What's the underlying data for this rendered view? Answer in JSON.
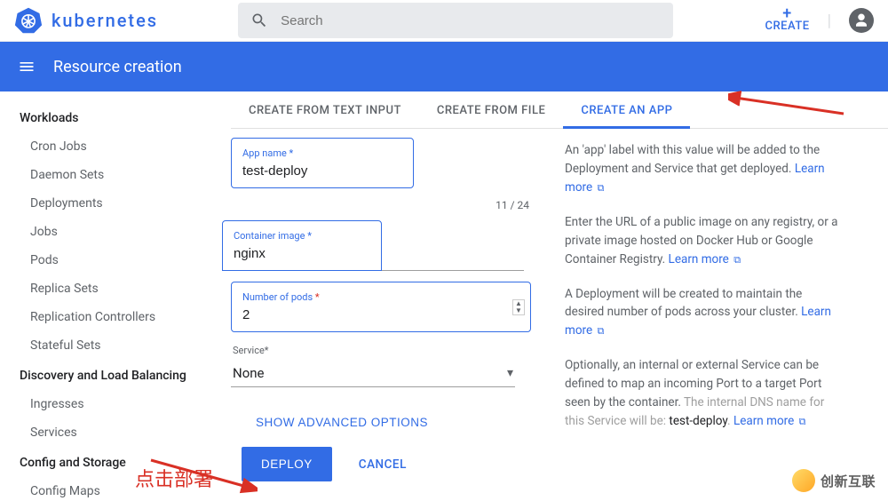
{
  "header": {
    "brand": "kubernetes",
    "search_placeholder": "Search",
    "create_label": "CREATE"
  },
  "subheader": {
    "title": "Resource creation"
  },
  "sidebar": {
    "sections": [
      {
        "title": "Workloads",
        "items": [
          "Cron Jobs",
          "Daemon Sets",
          "Deployments",
          "Jobs",
          "Pods",
          "Replica Sets",
          "Replication Controllers",
          "Stateful Sets"
        ]
      },
      {
        "title": "Discovery and Load Balancing",
        "items": [
          "Ingresses",
          "Services"
        ]
      },
      {
        "title": "Config and Storage",
        "items": [
          "Config Maps"
        ]
      }
    ]
  },
  "tabs": {
    "t0": "CREATE FROM TEXT INPUT",
    "t1": "CREATE FROM FILE",
    "t2": "CREATE AN APP",
    "active": 2
  },
  "form": {
    "app_name_label": "App name",
    "app_name_value": "test-deploy",
    "app_name_counter": "11 / 24",
    "container_image_label": "Container image",
    "container_image_value": "nginx",
    "pods_label": "Number of pods",
    "pods_value": "2",
    "service_label": "Service",
    "service_value": "None",
    "advanced": "SHOW ADVANCED OPTIONS",
    "deploy": "DEPLOY",
    "cancel": "CANCEL",
    "required_marker": "*"
  },
  "help": {
    "app_name": "An 'app' label with this value will be added to the Deployment and Service that get deployed.",
    "container_image": "Enter the URL of a public image on any registry, or a private image hosted on Docker Hub or Google Container Registry.",
    "pods": "A Deployment will be created to maintain the desired number of pods across your cluster.",
    "service": "Optionally, an internal or external Service can be defined to map an incoming Port to a target Port seen by the container.",
    "service_dns_prefix": "The internal DNS name for this Service will be: ",
    "service_dns_value": "test-deploy",
    "learn_more": "Learn more"
  },
  "annotations": {
    "deploy_cn": "点击部署"
  },
  "watermark": {
    "text": "创新互联"
  }
}
